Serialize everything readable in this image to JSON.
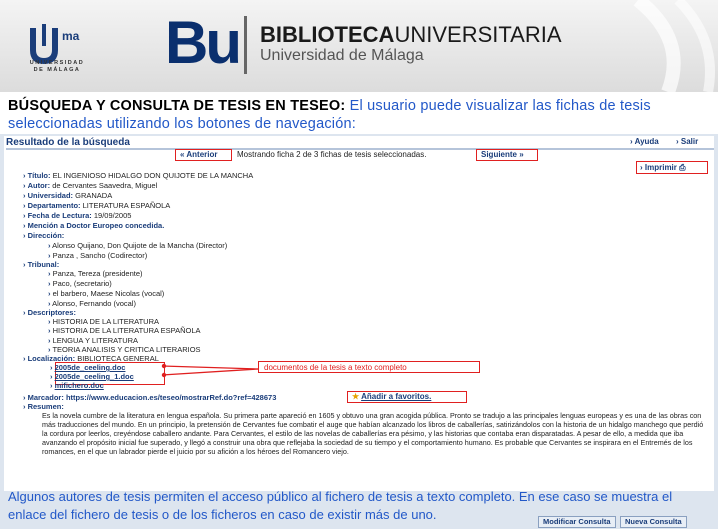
{
  "header": {
    "uma_mark": "ma",
    "uma_name_line1": "UNIVERSIDAD",
    "uma_name_line2": "DE MÁLAGA",
    "bu_logo": "Bu",
    "biblioteca_bold": "BIBLIOTECA",
    "biblioteca_rest": "UNIVERSITARIA",
    "universidad": "Universidad de Málaga"
  },
  "caption_top": {
    "bold": "BÚSQUEDA Y CONSULTA DE TESIS EN TESEO:",
    "text": " El usuario puede visualizar las fichas de tesis seleccionadas utilizando los botones de navegación:"
  },
  "toolbar": {
    "title": "Resultado de la búsqueda",
    "ayuda": "› Ayuda",
    "salir": "› Salir",
    "anterior": "« Anterior",
    "mostrando": "Mostrando ficha 2 de 3 fichas de tesis seleccionadas.",
    "siguiente": "Siguiente »",
    "imprimir": "› Imprimir"
  },
  "ficha": {
    "titulo_label": "Título:",
    "titulo": "EL INGENIOSO HIDALGO DON QUIJOTE DE LA MANCHA",
    "autor_label": "Autor:",
    "autor": "de Cervantes Saavedra, Miguel",
    "universidad_label": "Universidad:",
    "universidad": "GRANADA",
    "departamento_label": "Departamento:",
    "departamento": "LITERATURA ESPAÑOLA",
    "fecha_label": "Fecha de Lectura:",
    "fecha": "19/09/2005",
    "mencion": "Mención a Doctor Europeo concedida.",
    "direccion_label": "Dirección:",
    "direccion": [
      "Alonso Quijano, Don Quijote de la Mancha    (Director)",
      "Panza , Sancho    (Codirector)"
    ],
    "tribunal_label": "Tribunal:",
    "tribunal": [
      "Panza, Tereza    (presidente)",
      "Paco,    (secretario)",
      "el barbero, Maese Nicolas    (vocal)",
      "Alonso, Fernando    (vocal)"
    ],
    "descriptores_label": "Descriptores:",
    "descriptores": [
      "HISTORIA DE LA LITERATURA",
      "HISTORIA DE LA LITERATURA ESPAÑOLA",
      "LENGUA Y LITERATURA",
      "TEORIA ANALISIS Y CRITICA LITERARIOS"
    ],
    "localizacion_label": "Localización:",
    "localizacion": "BIBLIOTECA GENERAL",
    "ficheros": [
      "2005de_ceeling.doc",
      "2005de_ceeling_1.doc",
      "mifichero.doc"
    ],
    "callout": "documentos de la tesis a texto completo",
    "marcador_label": "Marcador:",
    "marcador": "https://www.educacion.es/teseo/mostrarRef.do?ref=428673",
    "favoritos": "Añadir a favoritos.",
    "resumen_label": "Resumen:",
    "resumen": "Es la novela cumbre de la literatura en lengua española. Su primera parte apareció en 1605 y obtuvo una gran acogida pública. Pronto se tradujo a las principales lenguas europeas y es una de las obras con más traducciones del mundo. En un principio, la pretensión de Cervantes fue combatir el auge que habían alcanzado los libros de caballerías, satirizándolos con la historia de un hidalgo manchego que perdió la cordura por leerlos, creyéndose caballero andante. Para Cervantes, el estilo de las novelas de caballerías era pésimo, y las historias que contaba eran disparatadas. A pesar de ello, a medida que iba avanzando el propósito inicial fue superado, y llegó a construir una obra que reflejaba la sociedad de su tiempo y el comportamiento humano. Es probable que Cervantes se inspirara en el Entremés de los romances, en el que un labrador pierde el juicio por su afición a los héroes del Romancero viejo."
  },
  "caption_bottom": "Algunos autores de tesis permiten el acceso público al fichero de tesis a texto completo. En ese caso se muestra el enlace del fichero de tesis o de los ficheros en caso de existir más de uno.",
  "bottom_buttons": {
    "modificar": "Modificar Consulta",
    "nueva": "Nueva Consulta"
  }
}
